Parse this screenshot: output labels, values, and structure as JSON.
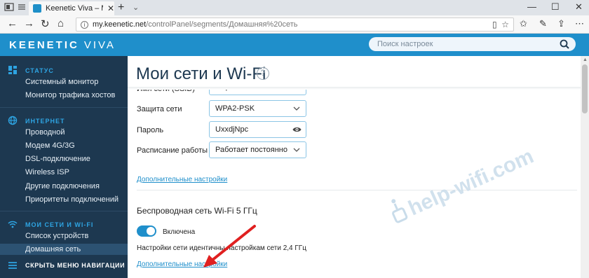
{
  "browser": {
    "tab_title": "Keenetic Viva – Мои сет",
    "url_host": "my.keenetic.net",
    "url_path": "/controlPanel/segments/Домашняя%20сеть"
  },
  "header": {
    "logo_main": "KEENETIC",
    "logo_model": "VIVA",
    "search_placeholder": "Поиск настроек"
  },
  "sidebar": {
    "status": {
      "title": "СТАТУС",
      "items": [
        "Системный монитор",
        "Монитор трафика хостов"
      ]
    },
    "internet": {
      "title": "ИНТЕРНЕТ",
      "items": [
        "Проводной",
        "Модем 4G/3G",
        "DSL-подключение",
        "Wireless ISP",
        "Другие подключения",
        "Приоритеты подключений"
      ]
    },
    "my_networks": {
      "title": "МОИ СЕТИ И WI-FI",
      "items": [
        "Список устройств",
        "Домашняя сеть"
      ]
    },
    "hide_nav_label": "СКРЫТЬ МЕНЮ НАВИГАЦИИ"
  },
  "main": {
    "title": "Мои сети и Wi-Fi",
    "fields": {
      "ssid_label": "Имя сети (SSID)",
      "ssid_value": "help-wifi.com",
      "security_label": "Защита сети",
      "security_value": "WPA2-PSK",
      "password_label": "Пароль",
      "password_value": "UxxdjNpc",
      "schedule_label": "Расписание работы",
      "schedule_value": "Работает постоянно"
    },
    "advanced_link_1": "Дополнительные настройки",
    "wifi5_title": "Беспроводная сеть Wi-Fi 5 ГГц",
    "wifi5_toggle_label": "Включена",
    "wifi5_note": "Настройки сети идентичны настройкам сети 2,4 ГГц",
    "advanced_link_2": "Дополнительные настройки",
    "watermark": "help-wifi.com"
  },
  "colors": {
    "brand_blue": "#1f8fcb",
    "sidebar_bg": "#1d3850",
    "arrow_red": "#e02020"
  }
}
